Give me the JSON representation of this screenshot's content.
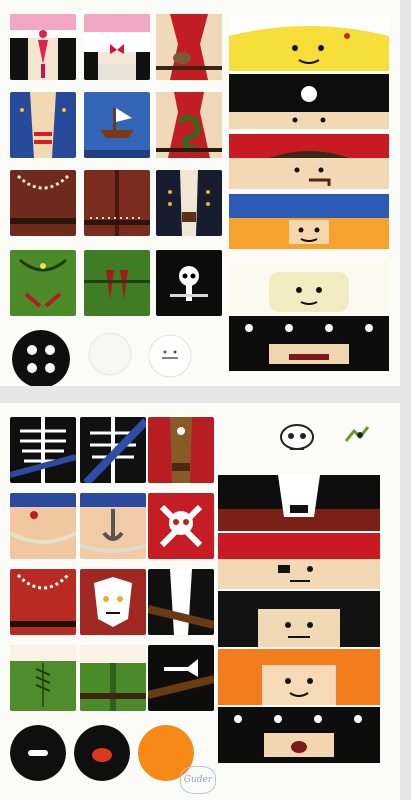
{
  "sheets": [
    {
      "name": "top-sheet",
      "torso_tiles": [
        "pink-bodice-torso",
        "pink-blouse-torso",
        "red-vest-torso",
        "blue-coat-torso",
        "blue-ship-shirt-torso",
        "red-snake-vest-torso",
        "brown-necklace-torso",
        "brown-coat-torso",
        "navy-coat-torso",
        "green-stars-torso",
        "green-daggers-torso",
        "skull-emblem-torso"
      ],
      "face_strips": [
        "yellow-bandana-face",
        "black-bandana-skull-face",
        "red-hat-pipe-face",
        "blue-hat-face",
        "white-skeleton-face",
        "skull-bandana-bearded-face"
      ],
      "round_pieces": [
        "black-skull-disc",
        "white-stamp-disc",
        "white-face-disc"
      ]
    },
    {
      "name": "bottom-sheet",
      "torso_tiles": [
        "skeleton-ribs-torso",
        "skeleton-sash-torso",
        "red-vest-torso",
        "tattoo-rope-torso",
        "anchor-rope-torso",
        "skull-crossbones-torso",
        "tooth-necklace-torso",
        "tiger-mask-torso",
        "black-coat-torso",
        "green-laced-torso",
        "green-dress-torso",
        "black-fish-torso"
      ],
      "face_strips": [
        "black-bandana-grin-face",
        "red-hat-eyepatch-face",
        "black-hair-face",
        "orange-hair-face",
        "skull-bandana-shout-face"
      ],
      "round_pieces": [
        "black-bone-disc",
        "black-crab-disc",
        "orange-disc"
      ],
      "loose_stickers": [
        "skull-sticker",
        "green-bug-sticker"
      ]
    }
  ],
  "signature_text": "Guder"
}
